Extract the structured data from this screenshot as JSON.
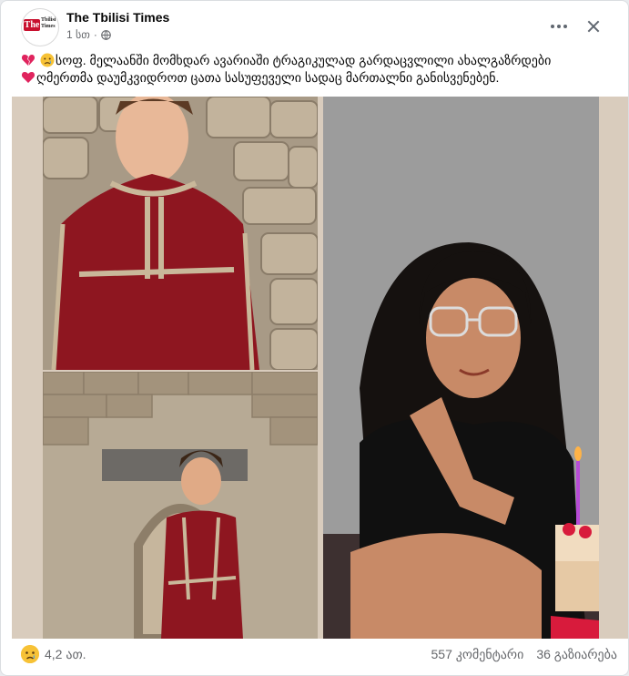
{
  "post": {
    "page_name": "The Tbilisi Times",
    "logo_text_top": "The",
    "logo_text_bottom": "Tbilisi Times",
    "time": "1 სთ",
    "separator": "·",
    "privacy_icon": "globe-icon",
    "text_line_1": "სოფ. მელაანში მომხდარ ავარიაში ტრაგიკულად გარდაცვლილი ახალგაზრდები",
    "text_line_2": "ღმერთმა დაუმკვიდროთ ცათა სასუფეველი სადაც მართალნი განისვენებენ.",
    "emoji_line_1": [
      "broken-heart-icon",
      "crying-face-icon"
    ],
    "emoji_line_2": [
      "red-heart-icon"
    ]
  },
  "photos": [
    {
      "name": "photo-boy-top-left",
      "subject": "boy in red robe, stone wall"
    },
    {
      "name": "photo-boy-bottom-left",
      "subject": "boy in red robe, stone arch"
    },
    {
      "name": "photo-girl-right",
      "subject": "girl with glasses, birthday cake"
    }
  ],
  "footer": {
    "reaction_icon": "sad-reaction-icon",
    "reactions_count": "4,2 ათ.",
    "comments": "557 კომენტარი",
    "shares": "36 გაზიარება"
  },
  "colors": {
    "robe_red": "#8e1620",
    "broken_heart": "#e0245e",
    "reaction_yellow": "#f7c236"
  }
}
